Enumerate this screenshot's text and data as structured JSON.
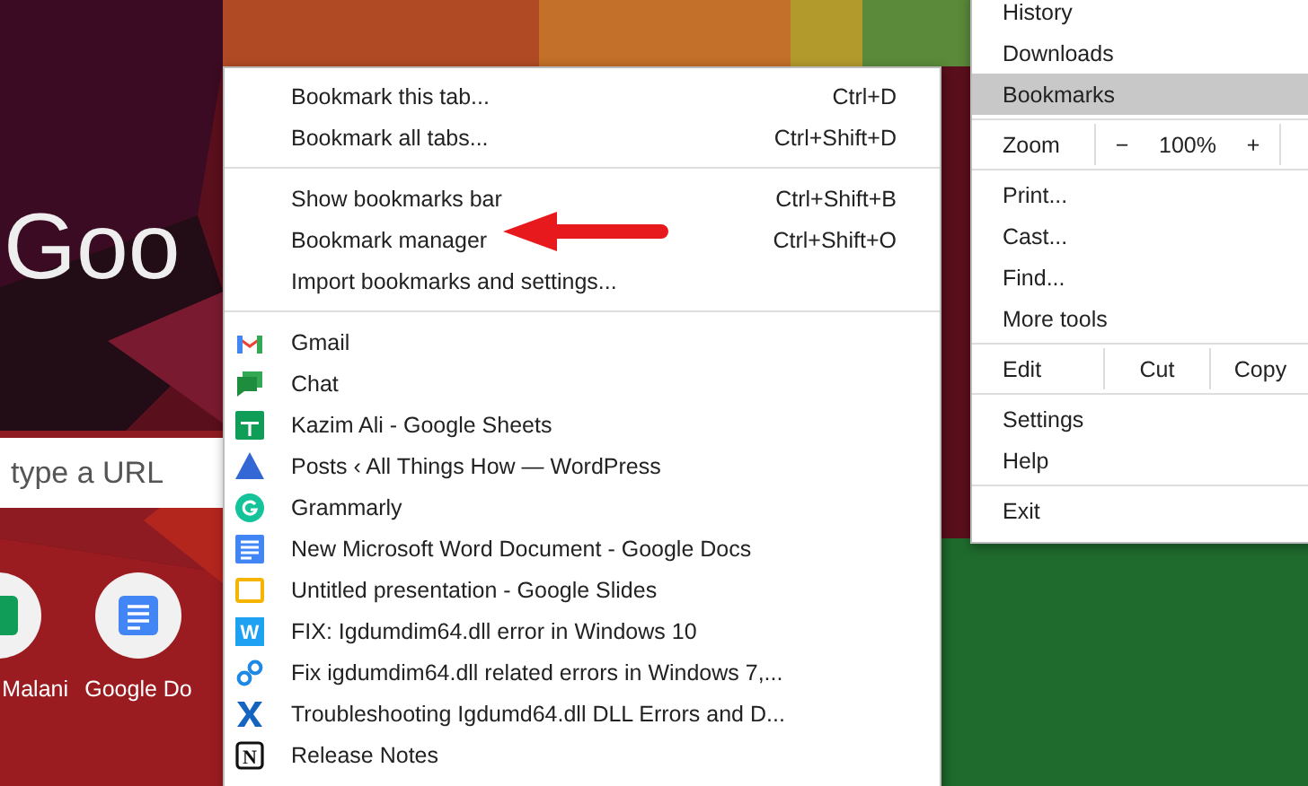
{
  "page": {
    "logo_text": "Goo",
    "search": {
      "placeholder": "type a URL"
    },
    "shortcuts": [
      {
        "label": "Malani",
        "kind": "green"
      },
      {
        "label": "Google Do",
        "kind": "doc"
      }
    ]
  },
  "main_menu": [
    {
      "kind": "item",
      "label": "History",
      "selected": false
    },
    {
      "kind": "item",
      "label": "Downloads",
      "selected": false
    },
    {
      "kind": "item",
      "label": "Bookmarks",
      "selected": true
    },
    {
      "kind": "separator"
    },
    {
      "kind": "zoom",
      "label": "Zoom",
      "minus": "−",
      "value": "100%",
      "plus": "+"
    },
    {
      "kind": "separator"
    },
    {
      "kind": "item",
      "label": "Print...",
      "selected": false
    },
    {
      "kind": "item",
      "label": "Cast...",
      "selected": false
    },
    {
      "kind": "item",
      "label": "Find...",
      "selected": false
    },
    {
      "kind": "item",
      "label": "More tools",
      "selected": false
    },
    {
      "kind": "separator"
    },
    {
      "kind": "edit",
      "label": "Edit",
      "cut": "Cut",
      "copy": "Copy"
    },
    {
      "kind": "separator"
    },
    {
      "kind": "item",
      "label": "Settings",
      "selected": false
    },
    {
      "kind": "item",
      "label": "Help",
      "selected": false
    },
    {
      "kind": "separator"
    },
    {
      "kind": "item",
      "label": "Exit",
      "selected": false
    }
  ],
  "bookmarks_menu": {
    "actions": [
      {
        "kind": "action",
        "label": "Bookmark this tab...",
        "shortcut": "Ctrl+D"
      },
      {
        "kind": "action",
        "label": "Bookmark all tabs...",
        "shortcut": "Ctrl+Shift+D"
      },
      {
        "kind": "separator"
      },
      {
        "kind": "action",
        "label": "Show bookmarks bar",
        "shortcut": "Ctrl+Shift+B"
      },
      {
        "kind": "action",
        "label": "Bookmark manager",
        "shortcut": "Ctrl+Shift+O"
      },
      {
        "kind": "action",
        "label": "Import bookmarks and settings..."
      },
      {
        "kind": "separator"
      }
    ],
    "bookmarks": [
      {
        "kind": "mail",
        "label": "Gmail"
      },
      {
        "kind": "chat",
        "label": "Chat"
      },
      {
        "kind": "sheet",
        "label": "Kazim Ali - Google Sheets"
      },
      {
        "kind": "triangle",
        "label": "Posts ‹ All Things How — WordPress"
      },
      {
        "kind": "ring",
        "label": "Grammarly"
      },
      {
        "kind": "doc",
        "label": "New Microsoft Word Document - Google Docs"
      },
      {
        "kind": "slide",
        "label": "Untitled presentation - Google Slides"
      },
      {
        "kind": "letter",
        "glyph": "W",
        "label": "FIX: Igdumdim64.dll error in Windows 10"
      },
      {
        "kind": "link",
        "label": "Fix igdumdim64.dll related errors in Windows 7,..."
      },
      {
        "kind": "cross",
        "label": "Troubleshooting Igdumd64.dll DLL Errors and D..."
      },
      {
        "kind": "boxed",
        "glyph": "N",
        "label": "Release Notes"
      }
    ]
  }
}
